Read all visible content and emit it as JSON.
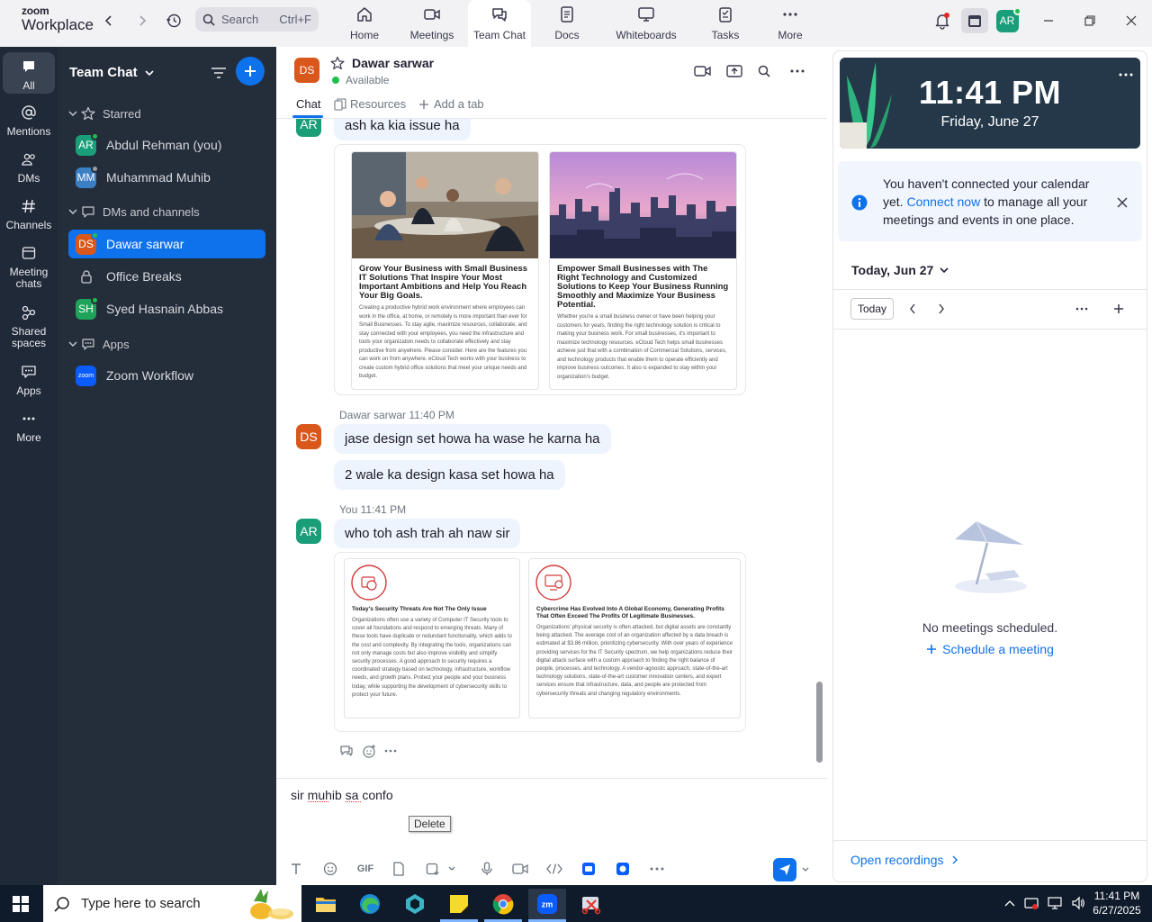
{
  "app": {
    "brand_top": "zoom",
    "brand_bottom": "Workplace"
  },
  "search": {
    "placeholder": "Search",
    "shortcut": "Ctrl+F"
  },
  "nav": {
    "tabs": [
      {
        "label": "Home",
        "icon": "home-icon"
      },
      {
        "label": "Meetings",
        "icon": "camera-icon"
      },
      {
        "label": "Team Chat",
        "icon": "chat-bubble-icon",
        "active": true
      },
      {
        "label": "Docs",
        "icon": "document-icon"
      },
      {
        "label": "Whiteboards",
        "icon": "whiteboard-icon"
      },
      {
        "label": "Tasks",
        "icon": "tasks-icon"
      },
      {
        "label": "More",
        "icon": "more-dots-icon"
      }
    ]
  },
  "user": {
    "initials": "AR"
  },
  "rail": {
    "items": [
      {
        "label": "All",
        "active": true
      },
      {
        "label": "Mentions"
      },
      {
        "label": "DMs"
      },
      {
        "label": "Channels"
      },
      {
        "label": "Meeting chats"
      },
      {
        "label": "Shared spaces"
      },
      {
        "label": "Apps"
      },
      {
        "label": "More"
      }
    ]
  },
  "sidebar": {
    "title": "Team Chat",
    "sections": {
      "starred": "Starred",
      "dms": "DMs and channels",
      "apps": "Apps"
    },
    "starred": [
      {
        "initials": "AR",
        "name": "Abdul Rehman (you)",
        "color": "#1a9e7a"
      },
      {
        "initials": "MM",
        "name": "Muhammad Muhib",
        "color": "#3b7fc4"
      }
    ],
    "dms": [
      {
        "initials": "DS",
        "name": "Dawar sarwar",
        "color": "#d9571b",
        "active": true
      },
      {
        "initials": "",
        "name": "Office Breaks",
        "icon": "lock-icon"
      },
      {
        "initials": "SH",
        "name": "Syed Hasnain Abbas",
        "color": "#1fa35a"
      }
    ],
    "apps": [
      {
        "initials": "zoom",
        "name": "Zoom Workflow",
        "color": "#0b5cff"
      }
    ]
  },
  "chat": {
    "contact": {
      "initials": "DS",
      "name": "Dawar sarwar",
      "status": "Available",
      "color": "#d9571b"
    },
    "tabs": {
      "chat": "Chat",
      "resources": "Resources",
      "add": "Add a tab"
    },
    "messages": {
      "m0": {
        "initials": "AR",
        "text": "ash ka kia issue ha"
      },
      "card1": {
        "title": "Grow Your Business with Small Business IT Solutions That Inspire Your Most Important Ambitions and Help You Reach Your Big Goals.",
        "body": "Creating a productive hybrid work environment where employees can work in the office, at home, or remotely is more important than ever for Small Businesses. To stay agile, maximize resources, collaborate, and stay connected with your employees, you need the infrastructure and tools your organization needs to collaborate effectively and stay productive from anywhere. Please consider. Here are the features you can work on from anywhere. eCloud Tech works with your business to create custom hybrid office solutions that meet your unique needs and budget."
      },
      "card2": {
        "title": "Empower Small Businesses with The Right Technology and Customized Solutions to Keep Your Business Running Smoothly and Maximize Your Business Potential.",
        "body": "Whether you're a small business owner or have been helping your customers for years, finding the right technology solution is critical to making your business work. For small businesses, it's important to maximize technology resources. eCloud Tech helps small businesses achieve just that with a combination of Commercial Solutions, services, and technology products that enable them to operate efficiently and improve business outcomes. It also is expanded to stay within your organization's budget."
      },
      "m1": {
        "initials": "DS",
        "sender": "Dawar sarwar",
        "time": "11:40 PM",
        "text": "jase design set howa ha wase he karna ha"
      },
      "m2": {
        "text": "2 wale ka design kasa set howa ha"
      },
      "m3": {
        "initials": "AR",
        "sender": "You",
        "time": "11:41 PM",
        "text": "who toh ash trah ah naw sir"
      },
      "card3": {
        "title": "Today's Security Threats Are Not The Only Issue",
        "body": "Organizations often use a variety of Computer IT Security tools to cover all foundations and respond to emerging threats. Many of these tools have duplicate or redundant functionality, which adds to the cost and complexity. By integrating the tools, organizations can not only manage costs but also improve visibility and simplify security processes. A good approach to security requires a coordinated strategy based on technology, infrastructure, workflow needs, and growth plans. Protect your people and your business today, while supporting the development of cybersecurity skills to protect your future."
      },
      "card4": {
        "title": "Cybercrime Has Evolved Into A Global Economy, Generating Profits That Often Exceed The Profits Of Legitimate Businesses.",
        "body": "Organizations' physical security is often attacked, but digital assets are constantly being attacked. The average cost of an organization affected by a data breach is estimated at $3.86 million, prioritizing cybersecurity. With over years of experience providing services for the IT Security spectrum, we help organizations reduce their digital attack surface with a custom approach to finding the right balance of people, processes, and technology. A vendor-agnostic approach, state-of-the-art technology solutions, state-of-the-art customer innovation centers, and expert services ensure that infrastructure, data, and people are protected from cybersecurity threats and changing regulatory environments."
      }
    },
    "composer": {
      "text": "sir muhib sa confo",
      "tooltip": "Delete"
    }
  },
  "calendar": {
    "time": "11:41 PM",
    "date": "Friday, June 27",
    "notice_pre": "You haven't connected your calendar yet.",
    "notice_link": "Connect now",
    "notice_post": "to manage all your meetings and events in one place.",
    "day_label": "Today, Jun 27",
    "today_btn": "Today",
    "empty": "No meetings scheduled.",
    "schedule": "Schedule a meeting",
    "recordings": "Open recordings"
  },
  "taskbar": {
    "search_placeholder": "Type here to search",
    "time": "11:41 PM",
    "date": "6/27/2025"
  }
}
